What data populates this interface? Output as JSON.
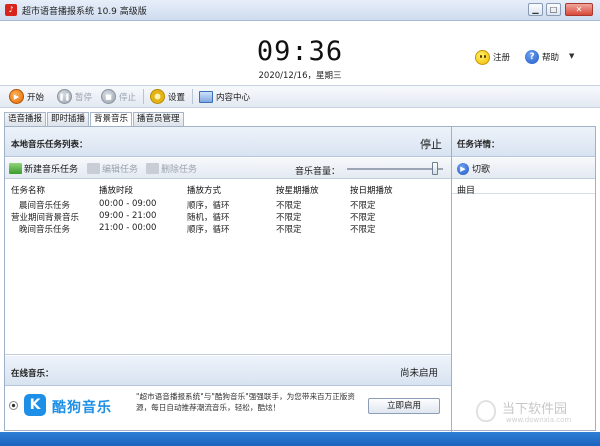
{
  "window": {
    "title": "超市语音播报系统 10.9 高级版",
    "app_icon": "app-logo-icon",
    "controls": {
      "minimize": "▁",
      "restore": "□",
      "close": "✕"
    }
  },
  "clock": {
    "time": "09:36",
    "date": "2020/12/16，星期三"
  },
  "header_links": {
    "register": "注册",
    "help": "帮助",
    "help_caret": "▼"
  },
  "toolbar": {
    "start": "开始",
    "pause": "暂停",
    "stop": "停止",
    "settings": "设置",
    "content_center": "内容中心"
  },
  "tabs": [
    {
      "label": "语音播报",
      "active": false
    },
    {
      "label": "即时插播",
      "active": false
    },
    {
      "label": "背景音乐",
      "active": true
    },
    {
      "label": "播音员管理",
      "active": false
    }
  ],
  "task_panel": {
    "title": "本地音乐任务列表：",
    "status": "停止",
    "buttons": {
      "new": "新建音乐任务",
      "edit": "编辑任务",
      "delete": "删除任务"
    },
    "volume_label": "音乐音量：",
    "volume_level": 0.92,
    "columns": [
      "任务名称",
      "播放时段",
      "播放方式",
      "按星期播放",
      "按日期播放"
    ],
    "rows": [
      [
        "晨间音乐任务",
        "00:00 - 09:00",
        "顺序，循环",
        "不限定",
        "不限定"
      ],
      [
        "营业期间背景音乐",
        "09:00 - 21:00",
        "随机，循环",
        "不限定",
        "不限定"
      ],
      [
        "晚间音乐任务",
        "21:00 - 00:00",
        "顺序，循环",
        "不限定",
        "不限定"
      ]
    ]
  },
  "online_panel": {
    "title": "在线音乐：",
    "status": "尚未启用",
    "brand": "酷狗音乐",
    "brand_mark": "K",
    "description": "\"超市语音播报系统\"与\"酷狗音乐\"强强联手，为您带来百万正版资源，每日自动推荐潮流音乐，轻松，酷炫！",
    "enable_button": "立即启用"
  },
  "details_panel": {
    "title": "任务详情：",
    "switch_song": "切歌",
    "column": "曲目"
  },
  "watermark": {
    "text": "当下软件园",
    "url": "www.downxia.com"
  },
  "colors": {
    "accent": "#1d8fe6",
    "statusbar": "#1a63be",
    "panel_header": "#d8e3f1"
  }
}
